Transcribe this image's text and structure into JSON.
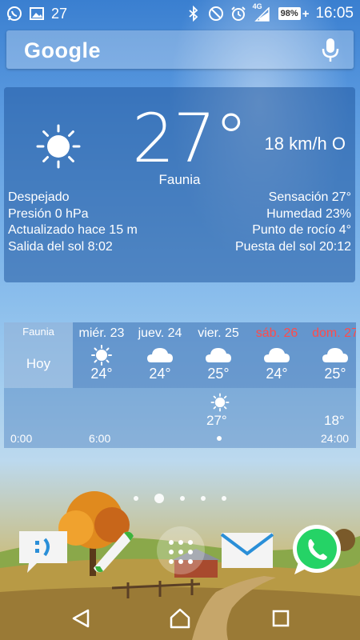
{
  "status_bar": {
    "left_icons": [
      "whatsapp-icon",
      "gallery-icon",
      "weather-notif-icon"
    ],
    "weather_notif_temp": "27",
    "right_icons": [
      "bluetooth-icon",
      "dnd-icon",
      "alarm-icon",
      "signal-icon"
    ],
    "network": "4G",
    "battery": "98%",
    "time": "16:05"
  },
  "search": {
    "logo": "Google"
  },
  "weather": {
    "temp": "27°",
    "place": "Faunia",
    "wind": "18 km/h O",
    "condition": "Despejado",
    "pressure": "Presión 0 hPa",
    "updated": "Actualizado hace 15 m",
    "sunrise": "Salida del sol 8:02",
    "feels_like": "Sensación 27°",
    "humidity": "Humedad 23%",
    "dew_point": "Punto de rocío 4°",
    "sunset": "Puesta del sol 20:12"
  },
  "forecast": {
    "place": "Faunia",
    "today_label": "Hoy",
    "days": [
      {
        "name": "miér. 23",
        "temp": "24°",
        "icon": "sun-icon",
        "weekend": false
      },
      {
        "name": "juev. 24",
        "temp": "24°",
        "icon": "cloud-icon",
        "weekend": false
      },
      {
        "name": "vier. 25",
        "temp": "25°",
        "icon": "cloud-icon",
        "weekend": false
      },
      {
        "name": "sáb. 26",
        "temp": "24°",
        "icon": "cloud-icon",
        "weekend": true
      },
      {
        "name": "dom. 27",
        "temp": "25°",
        "icon": "cloud-icon",
        "weekend": true
      }
    ],
    "hourly_now_temp": "27°",
    "hourly_night_temp": "18°",
    "hours": [
      "0:00",
      "6:00",
      "24:00"
    ]
  },
  "colors": {
    "weekend": "#ff4b4b",
    "whatsapp": "#25d366",
    "dock_email": "#2a8fd8"
  },
  "dock": [
    "messages-app-icon",
    "phone-app-icon",
    "app-drawer-icon",
    "email-app-icon",
    "whatsapp-app-icon"
  ],
  "navbar": [
    "back-icon",
    "home-icon",
    "recents-icon"
  ],
  "pager": {
    "pages": 5,
    "active": 1
  }
}
